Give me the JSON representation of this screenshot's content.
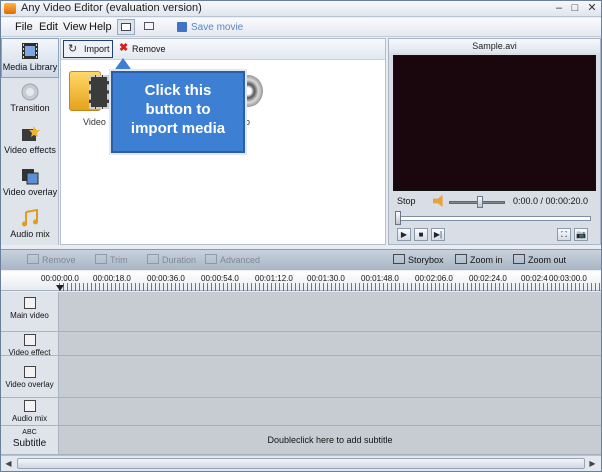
{
  "window": {
    "title": "Any Video Editor (evaluation version)",
    "minimize": "–",
    "maximize": "□",
    "close": "✕"
  },
  "menu": {
    "items": [
      "File",
      "Edit",
      "View",
      "Help"
    ],
    "save_movie": "Save movie"
  },
  "sidebar": {
    "items": [
      {
        "label": "Media Library",
        "icon": "film-icon",
        "active": true
      },
      {
        "label": "Transition",
        "icon": "transition-icon"
      },
      {
        "label": "Video effects",
        "icon": "effects-icon"
      },
      {
        "label": "Video overlay",
        "icon": "overlay-icon"
      },
      {
        "label": "Audio mix",
        "icon": "music-note-icon"
      }
    ]
  },
  "media": {
    "import_label": "Import",
    "remove_label": "Remove",
    "import_icon": "↻",
    "remove_icon": "✖",
    "items": [
      {
        "caption": "Video"
      },
      {
        "caption": "io"
      }
    ]
  },
  "callout": {
    "lines": [
      "Click this",
      "button to",
      "import media"
    ]
  },
  "preview": {
    "title": "Sample.avi",
    "status": "Stop",
    "time": "0:00.0 / 00:00:20.0",
    "buttons": [
      "▶",
      "■",
      "▶|"
    ],
    "snap_buttons": [
      "⛶",
      "📷"
    ]
  },
  "timeline": {
    "toolbar": {
      "remove": "Remove",
      "trim": "Trim",
      "duration": "Duration",
      "advanced": "Advanced",
      "storybox": "Storybox",
      "zoom_in": "Zoom in",
      "zoom_out": "Zoom out"
    },
    "ruler": [
      "00:00:00.0",
      "00:00:18.0",
      "00:00:36.0",
      "00:00:54.0",
      "00:01:12.0",
      "00:01:30.0",
      "00:01:48.0",
      "00:02:06.0",
      "00:02:24.0",
      "00:02:4",
      "00:03:00.0"
    ],
    "tracks": [
      {
        "label": "Main video"
      },
      {
        "label": "Video effect"
      },
      {
        "label": "Video overlay"
      },
      {
        "label": "Audio mix"
      },
      {
        "label": "Subtitle",
        "badge": "ABC"
      }
    ],
    "subtitle_hint": "Doubleclick here to add subtitle"
  },
  "colors": {
    "callout": "#3d7fd3",
    "screen": "#1a070e",
    "accent": "#3f73c6"
  }
}
